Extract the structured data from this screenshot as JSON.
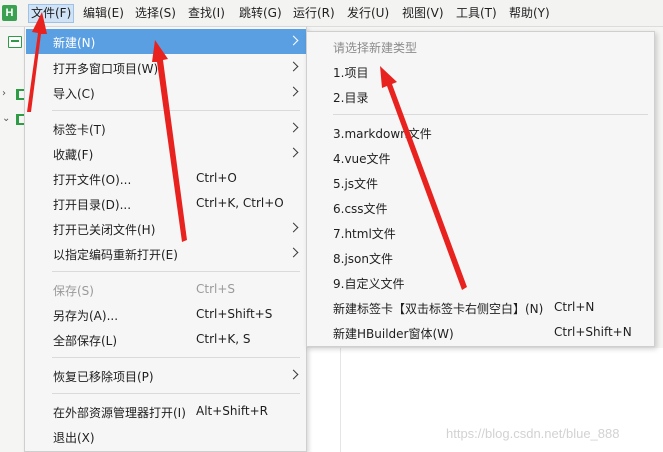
{
  "app": {
    "logo_text": "H"
  },
  "menubar": {
    "items": [
      {
        "label": "文件(F)"
      },
      {
        "label": "编辑(E)"
      },
      {
        "label": "选择(S)"
      },
      {
        "label": "查找(I)"
      },
      {
        "label": "跳转(G)"
      },
      {
        "label": "运行(R)"
      },
      {
        "label": "发行(U)"
      },
      {
        "label": "视图(V)"
      },
      {
        "label": "工具(T)"
      },
      {
        "label": "帮助(Y)"
      }
    ]
  },
  "file_menu": {
    "items": [
      {
        "label": "新建(N)",
        "shortcut": "",
        "submenu": true,
        "highlighted": true
      },
      {
        "label": "打开多窗口项目(W)",
        "shortcut": "",
        "submenu": true
      },
      {
        "label": "导入(C)",
        "shortcut": "",
        "submenu": true
      },
      {
        "label": "标签卡(T)",
        "shortcut": "",
        "submenu": true
      },
      {
        "label": "收藏(F)",
        "shortcut": "",
        "submenu": true
      },
      {
        "label": "打开文件(O)...",
        "shortcut": "Ctrl+O"
      },
      {
        "label": "打开目录(D)...",
        "shortcut": "Ctrl+K, Ctrl+O"
      },
      {
        "label": "打开已关闭文件(H)",
        "shortcut": "",
        "submenu": true
      },
      {
        "label": "以指定编码重新打开(E)",
        "shortcut": "",
        "submenu": true
      },
      {
        "label": "保存(S)",
        "shortcut": "Ctrl+S",
        "disabled": true
      },
      {
        "label": "另存为(A)...",
        "shortcut": "Ctrl+Shift+S"
      },
      {
        "label": "全部保存(L)",
        "shortcut": "Ctrl+K, S"
      },
      {
        "label": "恢复已移除项目(P)",
        "shortcut": "",
        "submenu": true
      },
      {
        "label": "在外部资源管理器打开(I)",
        "shortcut": "Alt+Shift+R"
      },
      {
        "label": "退出(X)",
        "shortcut": ""
      }
    ]
  },
  "new_submenu": {
    "header": "请选择新建类型",
    "items": [
      {
        "label": "1.项目",
        "shortcut": ""
      },
      {
        "label": "2.目录",
        "shortcut": ""
      },
      {
        "label": "3.markdown文件",
        "shortcut": ""
      },
      {
        "label": "4.vue文件",
        "shortcut": ""
      },
      {
        "label": "5.js文件",
        "shortcut": ""
      },
      {
        "label": "6.css文件",
        "shortcut": ""
      },
      {
        "label": "7.html文件",
        "shortcut": ""
      },
      {
        "label": "8.json文件",
        "shortcut": ""
      },
      {
        "label": "9.自定义文件",
        "shortcut": ""
      },
      {
        "label": "新建标签卡【双击标签卡右侧空白】(N)",
        "shortcut": "Ctrl+N"
      },
      {
        "label": "新建HBuilder窗体(W)",
        "shortcut": "Ctrl+Shift+N"
      }
    ]
  },
  "watermark": "https://blog.csdn.net/blue_888",
  "colors": {
    "highlight": "#5b9fe3",
    "annotation_arrow": "#e8231f",
    "brand_green": "#3aa150"
  }
}
